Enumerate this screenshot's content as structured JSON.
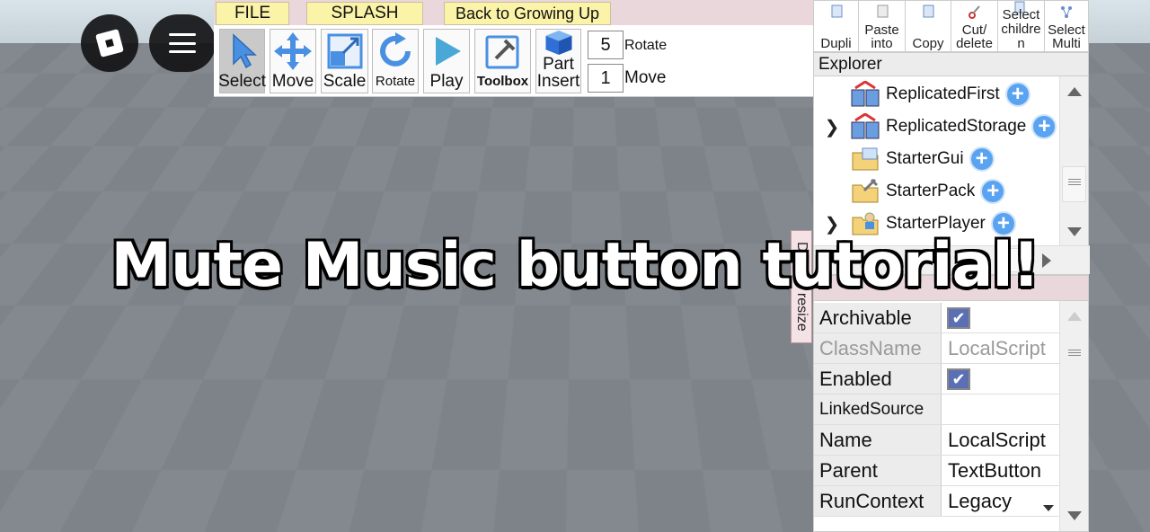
{
  "tabs": {
    "file": "FILE",
    "splash": "SPLASH",
    "back": "Back to Growing Up"
  },
  "tools": [
    {
      "label": "Select",
      "icon": "cursor-icon",
      "active": true
    },
    {
      "label": "Move",
      "icon": "move-arrows-icon"
    },
    {
      "label": "Scale",
      "icon": "scale-icon"
    },
    {
      "label": "Rotate",
      "icon": "rotate-icon"
    },
    {
      "label": "Play",
      "icon": "play-icon"
    },
    {
      "label": "Toolbox",
      "icon": "toolbox-icon"
    },
    {
      "label_top": "Part",
      "label": "Insert",
      "icon": "part-cube-icon"
    }
  ],
  "snap": {
    "rotate_value": "5",
    "rotate_label": "Rotate",
    "move_value": "1",
    "move_label": "Move"
  },
  "actions": [
    {
      "label": "Dupli"
    },
    {
      "label": "Paste\ninto"
    },
    {
      "label": "Copy"
    },
    {
      "label": "Cut/\ndelete"
    },
    {
      "label": "Select\nchildre\nn"
    },
    {
      "label": "Select\nMulti"
    }
  ],
  "explorer": {
    "title": "Explorer",
    "items": [
      {
        "label": "ReplicatedFirst",
        "expandable": false
      },
      {
        "label": "ReplicatedStorage",
        "expandable": true
      },
      {
        "label": "StarterGui",
        "expandable": false
      },
      {
        "label": "StarterPack",
        "expandable": false
      },
      {
        "label": "StarterPlayer",
        "expandable": true
      }
    ]
  },
  "resize_tab": "Drag to resize",
  "properties": [
    {
      "name": "Archivable",
      "type": "checkbox",
      "checked": true
    },
    {
      "name": "ClassName",
      "value": "LocalScript",
      "readonly": true
    },
    {
      "name": "Enabled",
      "type": "checkbox",
      "checked": true
    },
    {
      "name": "LinkedSource",
      "value": ""
    },
    {
      "name": "Name",
      "value": "LocalScript"
    },
    {
      "name": "Parent",
      "value": "TextButton"
    },
    {
      "name": "RunContext",
      "value": "Legacy",
      "dropdown": true
    }
  ],
  "overlay_title": "Mute Music button tutorial!",
  "colors": {
    "tab_yellow": "#fbf3a8",
    "header_pink": "#ead7db",
    "plus_blue": "#5aa3f0",
    "checkbox_blue": "#5b6fb5"
  }
}
